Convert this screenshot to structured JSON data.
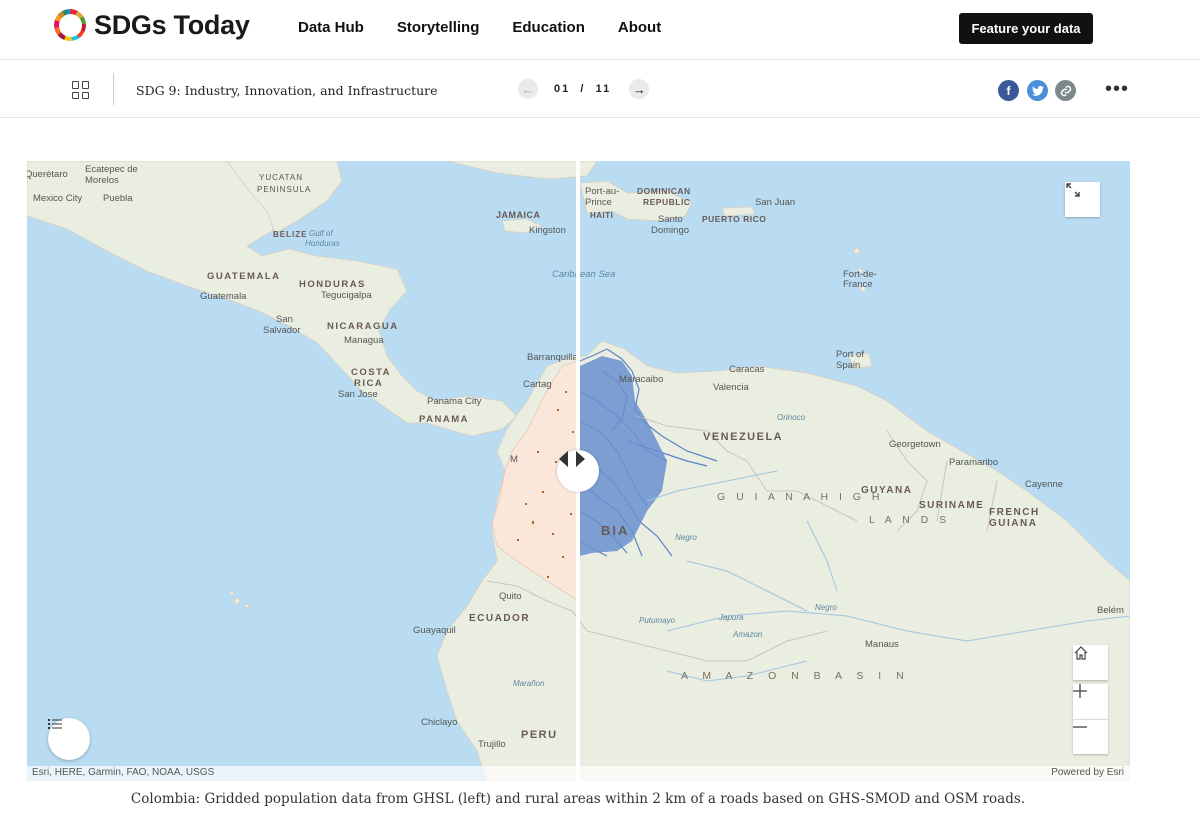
{
  "nav": {
    "brand": "SDGs Today",
    "links": [
      "Data Hub",
      "Storytelling",
      "Education",
      "About"
    ],
    "cta": "Feature your data"
  },
  "story": {
    "title": "SDG 9: Industry, Innovation, and Infrastructure",
    "page_current": "01",
    "page_sep": "/",
    "page_total": "11",
    "prev_arrow": "←",
    "next_arrow": "→",
    "share": {
      "facebook": "f",
      "twitter": "t",
      "link": "🔗"
    },
    "more": "•••"
  },
  "map": {
    "labels": {
      "queretaro": "Querétaro",
      "ecatepec": "Ecatepec de",
      "morelos": "Morelos",
      "mexico_city": "Mexico City",
      "puebla": "Puebla",
      "yucatan": "YUCATAN",
      "peninsula": "PENINSULA",
      "belize": "BELIZE",
      "gulf_hond1": "Gulf of",
      "gulf_hond2": "Honduras",
      "guatemala_country": "GUATEMALA",
      "guatemala_city": "Guatemala",
      "honduras": "HONDURAS",
      "tegucigalpa": "Tegucigalpa",
      "san_salvador1": "San",
      "san_salvador2": "Salvador",
      "nicaragua": "NICARAGUA",
      "managua": "Managua",
      "costa_rica1": "COSTA",
      "costa_rica2": "RICA",
      "san_jose": "San Jose",
      "panama_city": "Panama City",
      "panama": "PANAMA",
      "jamaica": "JAMAICA",
      "kingston": "Kingston",
      "caribbean_sea": "Caribbean Sea",
      "barranquilla": "Barranquilla",
      "cartagena": "Cartag",
      "port_au_prince1": "Port-au-",
      "port_au_prince2": "Prince",
      "haiti": "HAITI",
      "dominican1": "DOMINICAN",
      "dominican2": "REPUBLIC",
      "santo1": "Santo",
      "santo2": "Domingo",
      "puerto_rico": "PUERTO RICO",
      "san_juan": "San Juan",
      "fort_de_france1": "Fort-de-",
      "fort_de_france2": "France",
      "port_of_spain1": "Port of",
      "port_of_spain2": "Spain",
      "maracaibo": "Maracaibo",
      "caracas": "Caracas",
      "valencia": "Valencia",
      "venezuela": "VENEZUELA",
      "georgetown": "Georgetown",
      "paramaribo": "Paramaribo",
      "cayenne": "Cayenne",
      "guyana": "GUYANA",
      "suriname": "SURINAME",
      "french_guiana1": "FRENCH",
      "french_guiana2": "GUIANA",
      "guiana_highlands1": "G U I A N A   H I G H",
      "guiana_highlands2": "L A N D S",
      "colombia_partial": "BIA",
      "medellin_partial": "M",
      "quito": "Quito",
      "ecuador": "ECUADOR",
      "guayaquil": "Guayaquil",
      "manaus": "Manaus",
      "belem": "Belém",
      "amazon_basin": "A M A Z O N     B A S I N",
      "peru": "PERU",
      "chiclayo": "Chiclayo",
      "trujillo": "Trujillo",
      "river_negro": "Negro",
      "river_negro2": "Negro",
      "river_japura": "Japura",
      "river_amazon": "Amazon",
      "river_putumayo": "Putumayo",
      "river_maranon": "Marañon",
      "river_orinoco": "Orinoco"
    },
    "attribution_left": "Esri, HERE, Garmin, FAO, NOAA, USGS",
    "attribution_right": "Powered by Esri",
    "colors": {
      "ocean": "#b9dcf2",
      "land": "#e9eee0",
      "population_area": "#fbe6da",
      "roads": "#5b82c8"
    }
  },
  "caption": "Colombia: Gridded population data from GHSL (left) and rural areas within 2 km of a roads based on GHS-SMOD and OSM roads."
}
